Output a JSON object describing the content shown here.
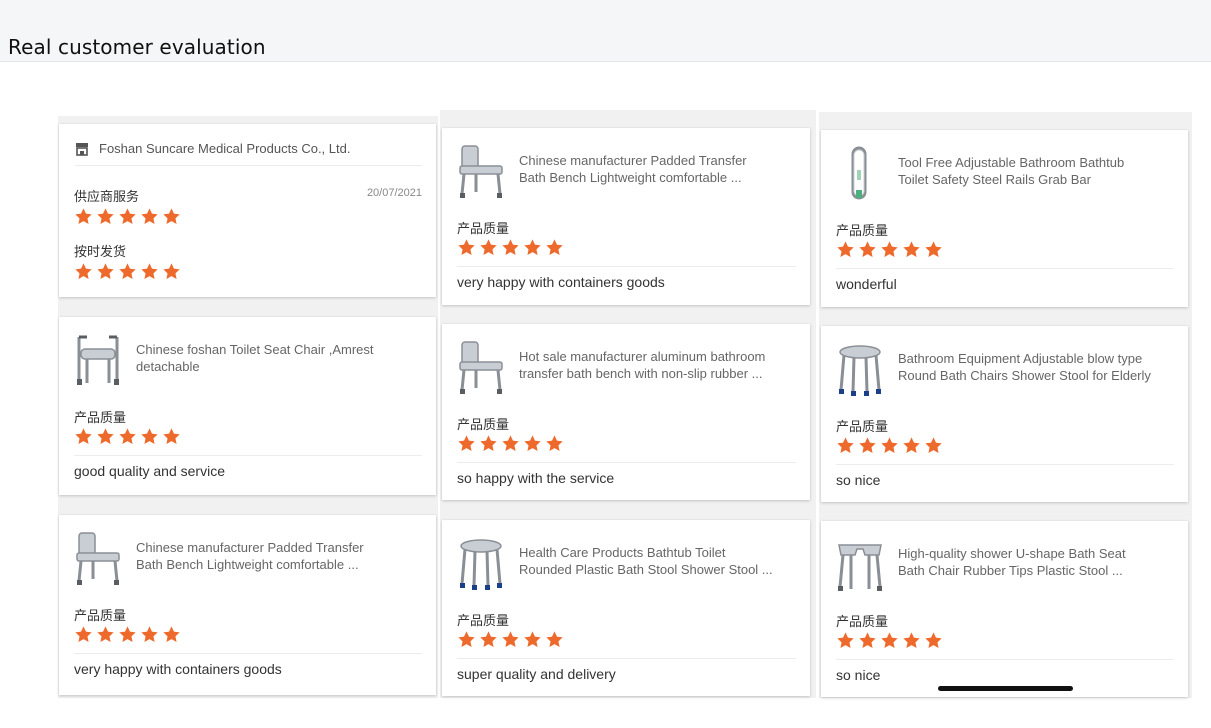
{
  "header": {
    "title": "Real customer evaluation"
  },
  "colors": {
    "star": "#ee6a2c",
    "header_bg": "#f5f6f8"
  },
  "store_card": {
    "shop_icon": "store-icon",
    "shop_name": "Foshan Suncare Medical Products Co., Ltd.",
    "date": "20/07/2021",
    "scores": [
      {
        "label": "供应商服务",
        "stars": 5
      },
      {
        "label": "按时发货",
        "stars": 5
      }
    ]
  },
  "quality_label": "产品质量",
  "products": [
    {
      "title_line1": "Chinese manufacturer Padded Transfer",
      "title_line2": "Bath Bench Lightweight comfortable  ...",
      "stars": 5,
      "comment": "very happy with containers goods",
      "icon": "transfer-bench-icon"
    },
    {
      "title_line1": "Tool Free Adjustable Bathroom Bathtub",
      "title_line2": "Toilet Safety Steel Rails Grab Bar",
      "stars": 5,
      "comment": "wonderful",
      "icon": "grab-bar-icon"
    },
    {
      "title_line1": "Chinese foshan Toilet Seat Chair ,Amrest",
      "title_line2": "detachable",
      "stars": 5,
      "comment": "good quality and service",
      "icon": "toilet-chair-icon"
    },
    {
      "title_line1": "Hot sale manufacturer aluminum bathroom",
      "title_line2": "transfer bath bench with non-slip rubber ...",
      "stars": 5,
      "comment": "so happy with the service",
      "icon": "transfer-bench-icon"
    },
    {
      "title_line1": "Bathroom Equipment Adjustable blow type",
      "title_line2": "Round Bath Chairs Shower Stool for Elderly",
      "stars": 5,
      "comment": "so nice",
      "icon": "round-stool-icon"
    },
    {
      "title_line1": "Chinese manufacturer Padded Transfer",
      "title_line2": "Bath Bench Lightweight comfortable  ...",
      "stars": 5,
      "comment": "very happy with containers goods",
      "icon": "transfer-bench-icon"
    },
    {
      "title_line1": "Health Care Products Bathtub Toilet",
      "title_line2": "Rounded Plastic Bath Stool Shower Stool ...",
      "stars": 5,
      "comment": "super quality and delivery",
      "icon": "round-stool-icon"
    },
    {
      "title_line1": "High-quality shower U-shape Bath Seat",
      "title_line2": "Bath Chair Rubber Tips Plastic Stool ...",
      "stars": 5,
      "comment": "so nice",
      "icon": "u-shape-seat-icon"
    }
  ]
}
